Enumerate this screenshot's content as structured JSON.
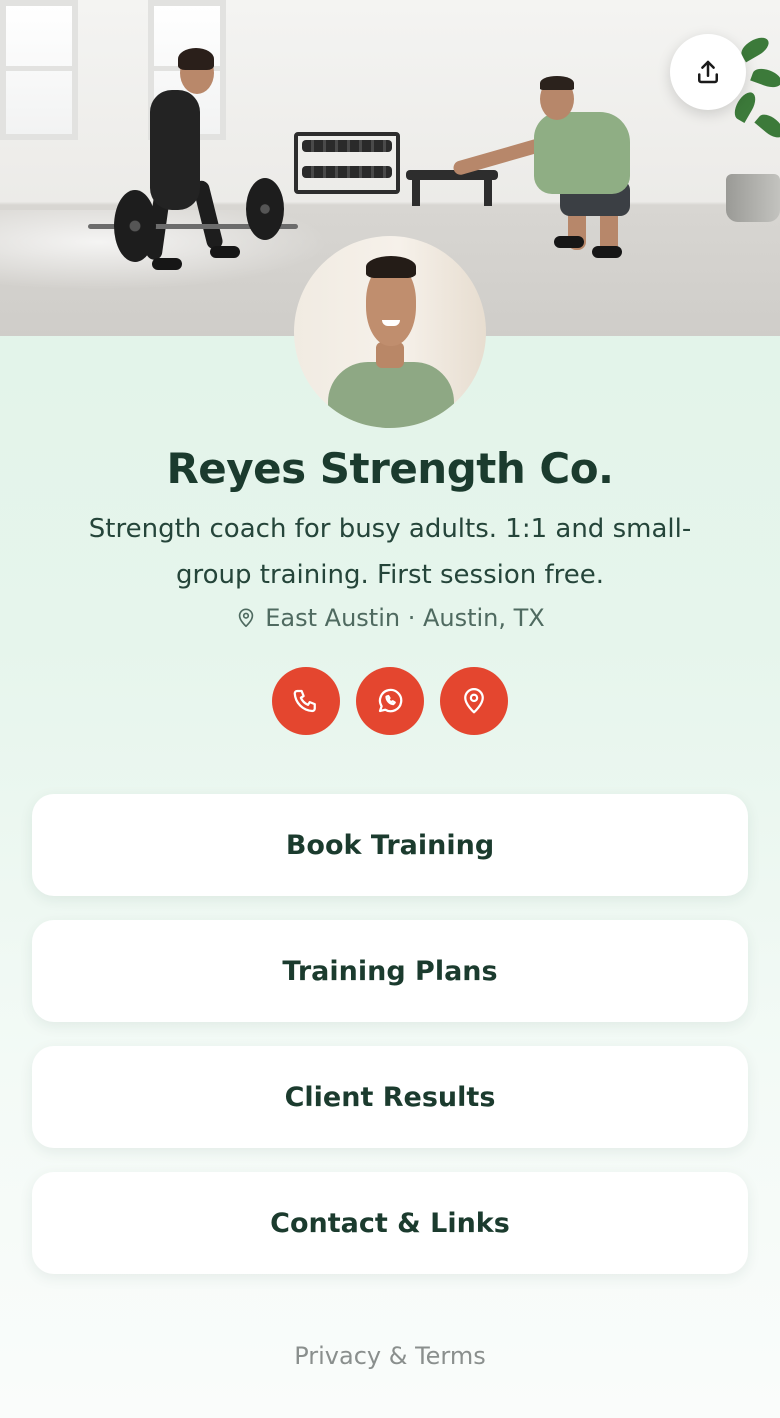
{
  "cover": {
    "image": "gym-training-photo"
  },
  "share": {
    "icon": "share-upload-icon"
  },
  "profile": {
    "avatar": "coach-portrait",
    "name": "Reyes Strength Co.",
    "bio": "Strength coach for busy adults. 1:1 and small-group training. First session free.",
    "location": "East Austin · Austin, TX",
    "location_icon": "map-pin-icon"
  },
  "actions": [
    {
      "name": "phone",
      "icon": "phone-icon"
    },
    {
      "name": "whatsapp",
      "icon": "whatsapp-icon"
    },
    {
      "name": "map",
      "icon": "map-pin-icon"
    }
  ],
  "links": [
    {
      "label": "Book Training"
    },
    {
      "label": "Training Plans"
    },
    {
      "label": "Client Results"
    },
    {
      "label": "Contact & Links"
    }
  ],
  "footer": {
    "privacy_label": "Privacy & Terms"
  },
  "colors": {
    "accent": "#e4462f",
    "text_dark": "#1b3b2e",
    "background_top": "#dff3e7",
    "background_bottom": "#fafcfb"
  }
}
